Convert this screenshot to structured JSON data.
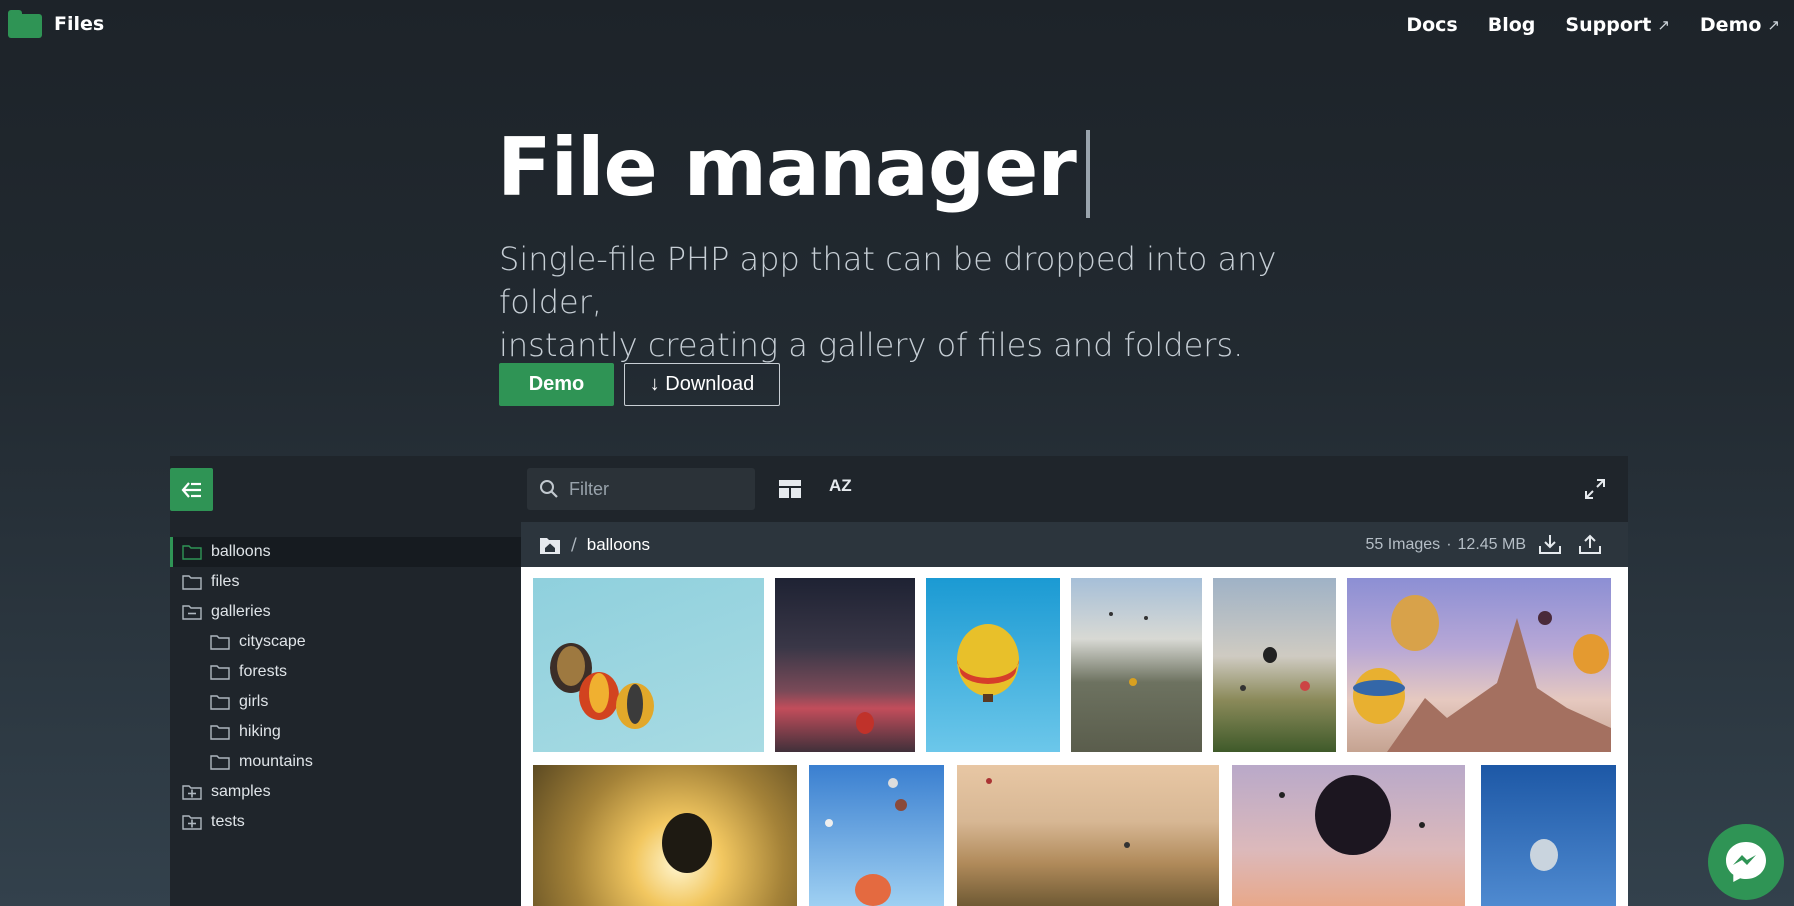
{
  "header": {
    "app_name": "Files",
    "nav": [
      {
        "label": "Docs",
        "external": false
      },
      {
        "label": "Blog",
        "external": false
      },
      {
        "label": "Support",
        "external": true
      },
      {
        "label": "Demo",
        "external": true
      }
    ],
    "external_glyph": "↗"
  },
  "hero": {
    "title": "File manager",
    "subtitle_line1": "Single-file PHP app that can be dropped into any folder,",
    "subtitle_line2": "instantly creating a gallery of files and folders.",
    "demo_button": "Demo",
    "download_button": "↓ Download"
  },
  "colors": {
    "accent": "#2f9455",
    "dark": "#1f252b"
  },
  "app": {
    "filter_placeholder": "Filter",
    "sort_label": "AZ",
    "breadcrumb": {
      "separator": "/",
      "current": "balloons"
    },
    "info": {
      "count": "55 Images",
      "separator": "·",
      "size": "12.45 MB"
    },
    "tree": [
      {
        "label": "balloons",
        "icon": "folder-icon",
        "level": 0,
        "active": true
      },
      {
        "label": "files",
        "icon": "folder-icon",
        "level": 0
      },
      {
        "label": "galleries",
        "icon": "folder-collapse-icon",
        "level": 0
      },
      {
        "label": "cityscape",
        "icon": "folder-icon",
        "level": 1
      },
      {
        "label": "forests",
        "icon": "folder-icon",
        "level": 1
      },
      {
        "label": "girls",
        "icon": "folder-icon",
        "level": 1
      },
      {
        "label": "hiking",
        "icon": "folder-icon",
        "level": 1
      },
      {
        "label": "mountains",
        "icon": "folder-icon",
        "level": 1
      },
      {
        "label": "samples",
        "icon": "folder-expand-icon",
        "level": 0
      },
      {
        "label": "tests",
        "icon": "folder-expand-icon",
        "level": 0
      }
    ]
  }
}
